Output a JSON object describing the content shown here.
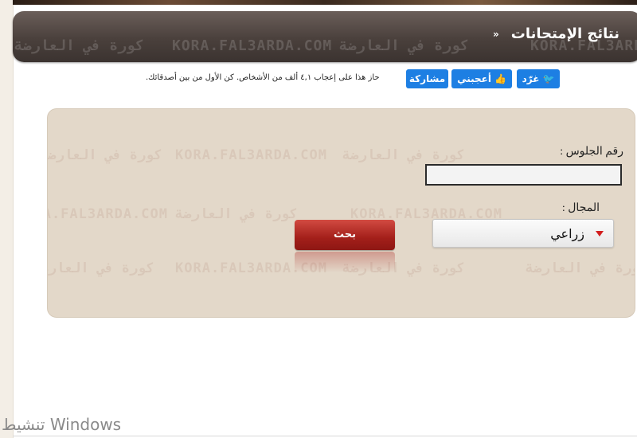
{
  "header": {
    "title": "نتائج الإمتحانات",
    "chevrons": "»",
    "watermark_arabic": "كورة في العارضة",
    "watermark_latin": "KORA.FAL3ARDA.COM"
  },
  "social": {
    "tweet_label": "غرّد",
    "like_label": "أعجبني",
    "share_label": "مشاركة",
    "like_text": "حاز هذا على إعجاب ٤,١ ألف من الأشخاص. كن الأول من بين أصدقائك.",
    "button_color": "#1d7fe3",
    "icons": [
      "twitter-bird-icon",
      "thumbs-up-icon"
    ]
  },
  "form": {
    "seat_label": "رقم الجلوس :",
    "seat_value": "",
    "field_label": "المجال :",
    "field_selected": "زراعي",
    "search_label": "بحث",
    "panel_color": "#e3d8c9",
    "button_color": "#b32822"
  },
  "system": {
    "activate_windows": "تنشيط Windows"
  }
}
